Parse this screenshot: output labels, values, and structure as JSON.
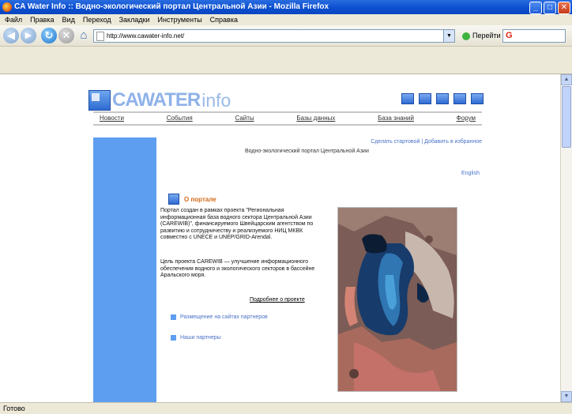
{
  "window": {
    "title": "CA Water Info :: Водно-экологический портал Центральной Азии - Mozilla Firefox",
    "minimize": "_",
    "maximize": "□",
    "close": "✕"
  },
  "menu": [
    "Файл",
    "Правка",
    "Вид",
    "Переход",
    "Закладки",
    "Инструменты",
    "Справка"
  ],
  "navbar": {
    "url": "http://www.cawater-info.net/",
    "go_label": "Перейти",
    "search_glyph": "G"
  },
  "status": "Готово",
  "site": {
    "logo_main": "CAWATER",
    "logo_suffix": "info",
    "nav": [
      "Новости",
      "События",
      "Сайты",
      "Базы данных",
      "База знаний",
      "Форум"
    ],
    "top_link": "Сделать стартовой | Добавить в избранное",
    "subtitle": "Водно-экологический портал Центральной Азии",
    "english": "English",
    "about_title": "О портале",
    "para1": "Портал создан в рамках проекта \"Региональная информационная база водного сектора Центральной Азии (CAREWIB)\", финансируемого Швейцарским агентством по развитию и сотрудничеству и реализуемого НИЦ МКВК совместно с UNECE и UNEP/GRID-Arendal.",
    "para2": "Цель проекта CAREWIB — улучшение информационного обеспечения водного и экологического секторов в бассейне Аральского моря.",
    "more": "Подробнее о проекте",
    "link1": "Размещение на сайтах партнеров",
    "link2": "Наши партнеры"
  },
  "colors": {
    "accent_blue": "#5e9ef0",
    "link_blue": "#4a72c8",
    "heading_orange": "#d46a1a"
  }
}
